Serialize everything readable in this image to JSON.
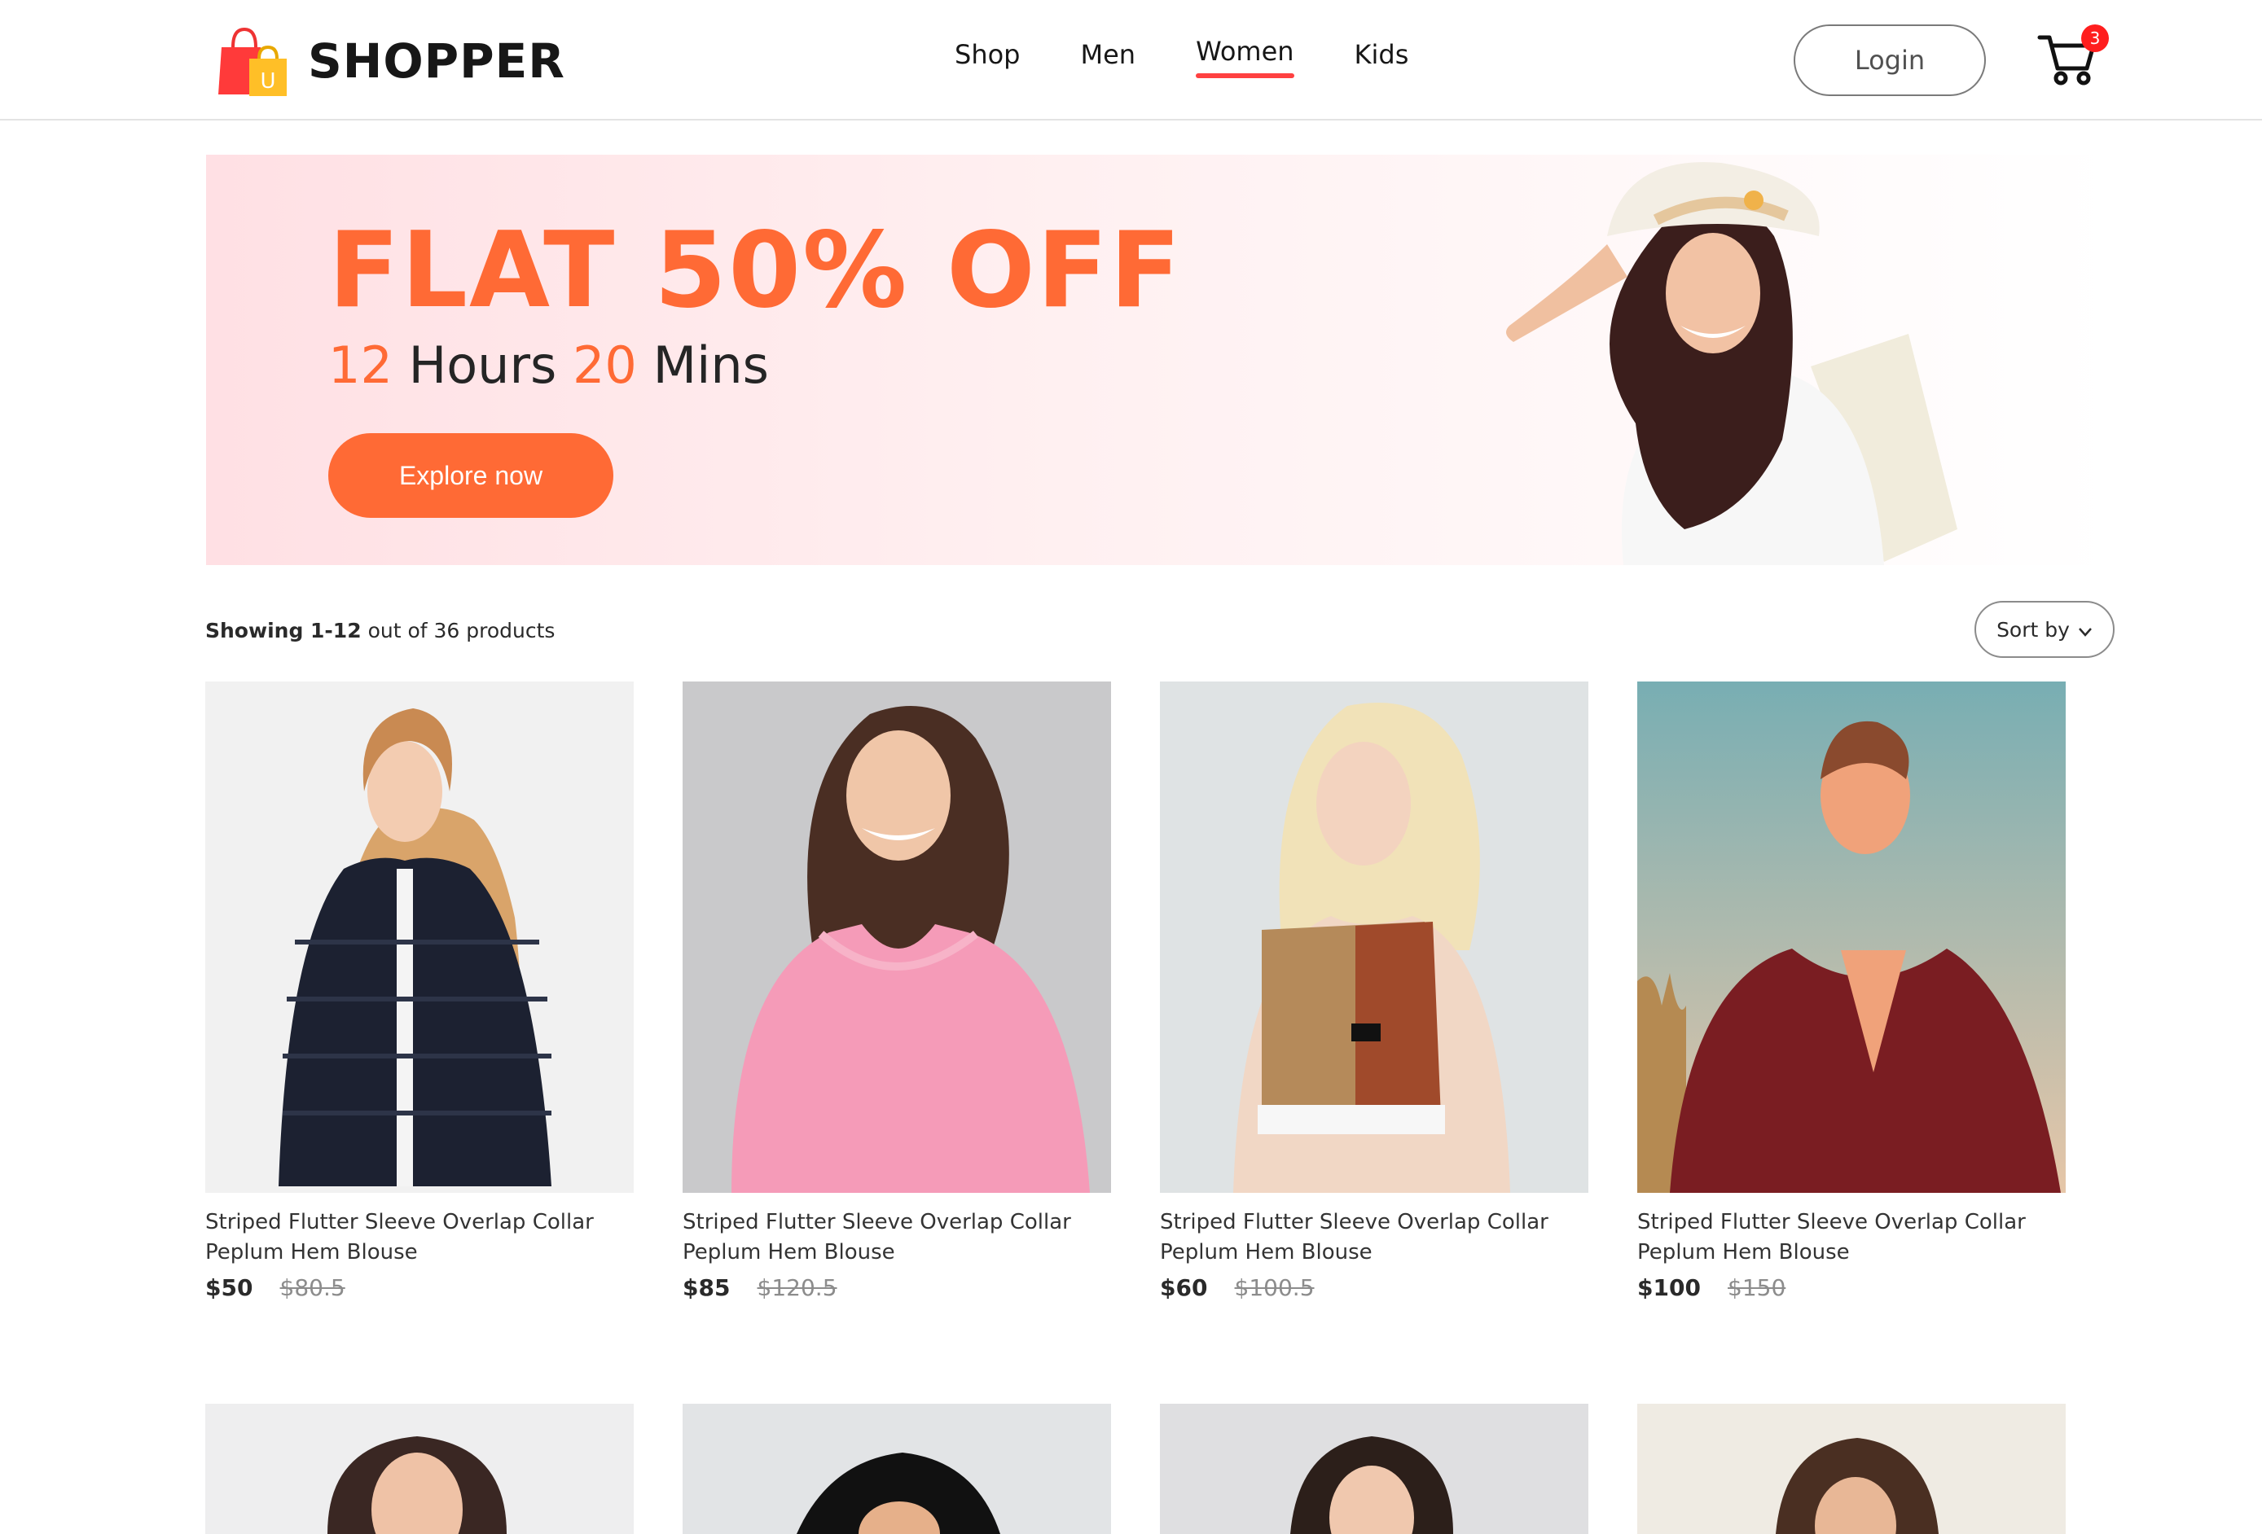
{
  "brand": {
    "name": "SHOPPER",
    "logo_letter": "U"
  },
  "nav": {
    "items": [
      {
        "label": "Shop"
      },
      {
        "label": "Men"
      },
      {
        "label": "Women"
      },
      {
        "label": "Kids"
      }
    ],
    "active": "Women"
  },
  "header": {
    "login_label": "Login",
    "cart_count": "3"
  },
  "hero": {
    "headline": "FLAT 50% OFF",
    "timer_hours": "12",
    "hours_label": "Hours",
    "timer_mins": "20",
    "mins_label": "Mins",
    "cta_label": "Explore now"
  },
  "listing": {
    "results_prefix": "Showing 1-12",
    "results_suffix": "out of 36 products",
    "sort_label": "Sort by"
  },
  "products": [
    {
      "name": "Striped Flutter Sleeve Overlap Collar Peplum Hem Blouse",
      "new_price": "$50",
      "old_price": "$80.5"
    },
    {
      "name": "Striped Flutter Sleeve Overlap Collar Peplum Hem Blouse",
      "new_price": "$85",
      "old_price": "$120.5"
    },
    {
      "name": "Striped Flutter Sleeve Overlap Collar Peplum Hem Blouse",
      "new_price": "$60",
      "old_price": "$100.5"
    },
    {
      "name": "Striped Flutter Sleeve Overlap Collar Peplum Hem Blouse",
      "new_price": "$100",
      "old_price": "$150"
    }
  ],
  "colors": {
    "accent": "#ff6a35",
    "nav_underline": "#ff4141",
    "badge": "#ff1e1e",
    "hero_bg": "#ffe0e4"
  },
  "icons": {
    "cart": "shopping-cart-icon",
    "sort": "chevron-down-icon"
  }
}
